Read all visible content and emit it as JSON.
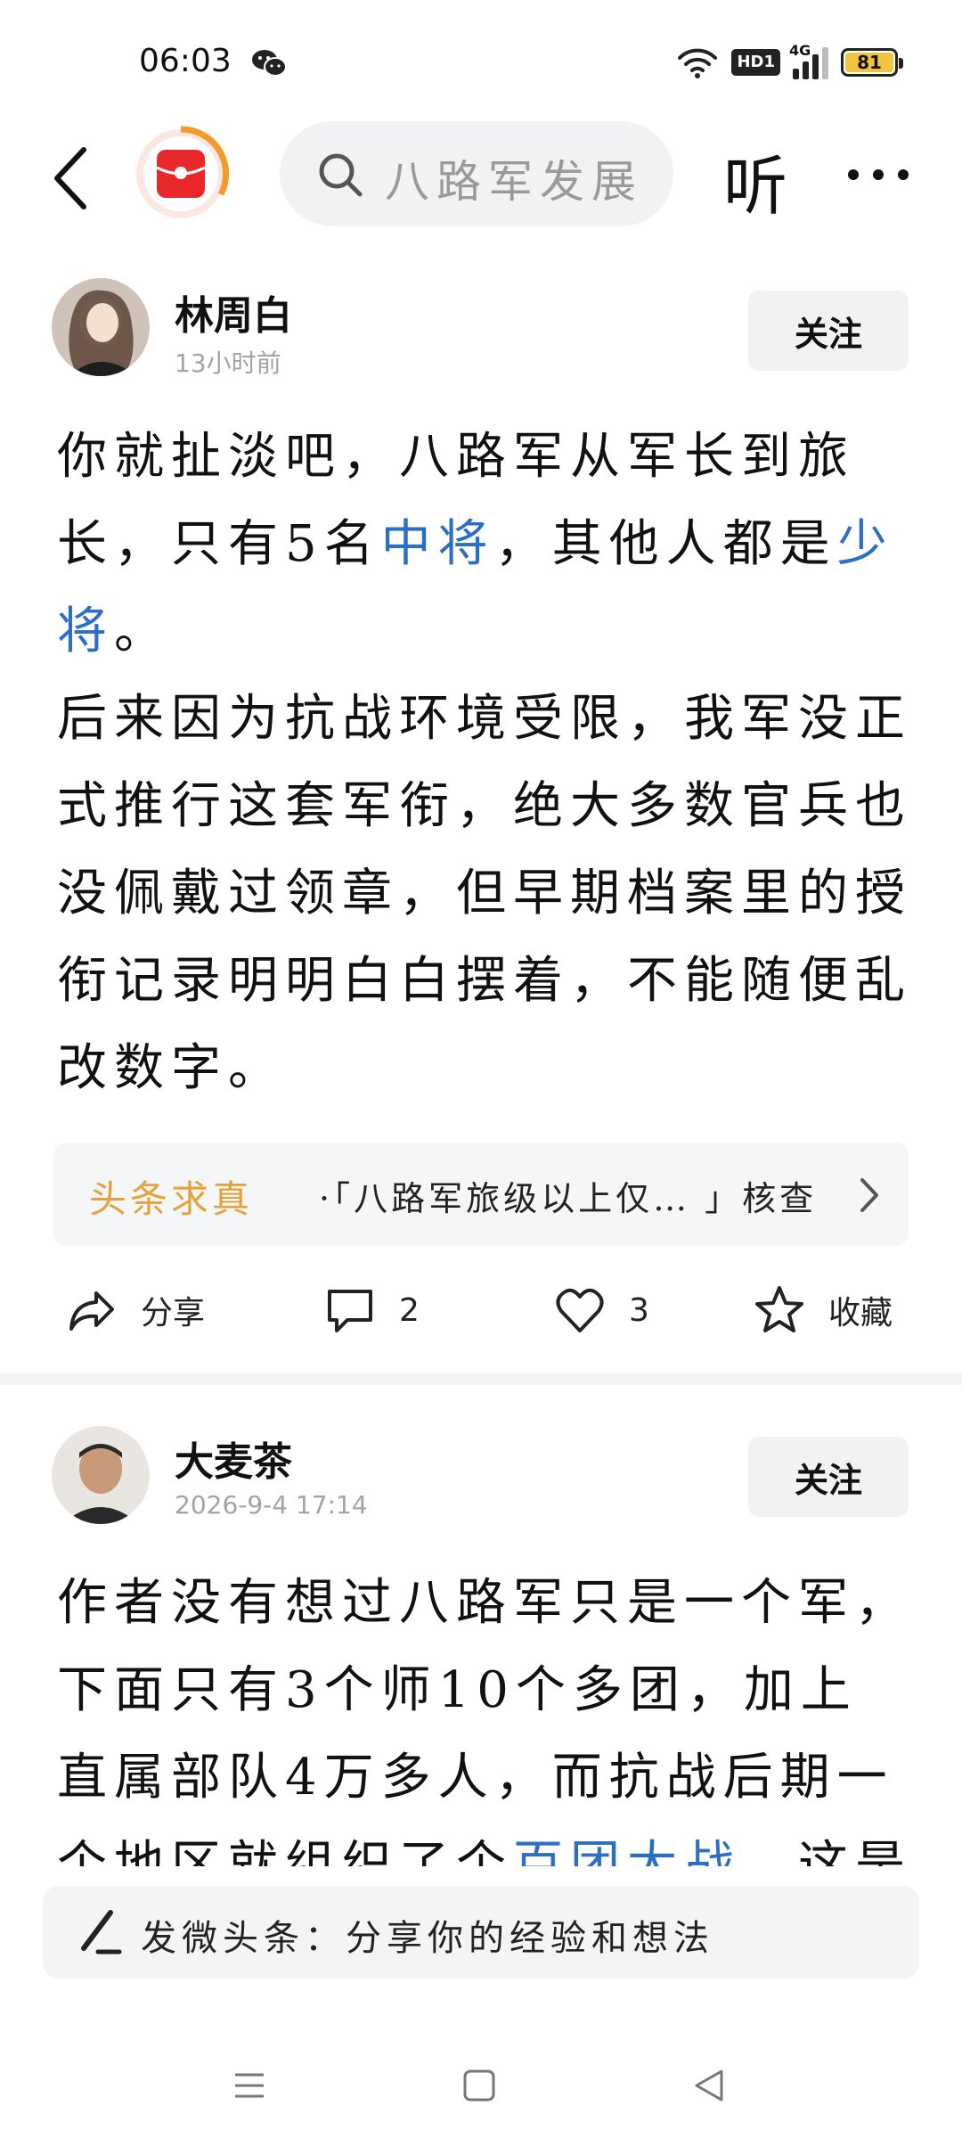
{
  "status": {
    "time": "06:03",
    "hd_label": "HD1",
    "net_label": "4G",
    "battery": "81",
    "icons": [
      "wechat-icon",
      "wifi-icon",
      "hd-icon",
      "signal-icon",
      "battery-icon"
    ]
  },
  "topnav": {
    "search_placeholder": "八路军发展",
    "listen_label": "听",
    "icons": [
      "back-icon",
      "red-packet-icon",
      "search-icon",
      "more-icon"
    ]
  },
  "posts": [
    {
      "author": "林周白",
      "time": "13小时前",
      "follow_label": "关注",
      "body": [
        {
          "text": "你就扯淡吧，八路军从军长到旅长，只有5名",
          "link": false
        },
        {
          "text": "中将",
          "link": true
        },
        {
          "text": "，其他人都是",
          "link": false
        },
        {
          "text": "少将",
          "link": true
        },
        {
          "text": "。",
          "link": false
        }
      ],
      "body2": "后来因为抗战环境受限，我军没正式推行这套军衔，绝大多数官兵也没佩戴过领章，但早期档案里的授衔记录明明白白摆着，不能随便乱改数字。",
      "factcheck": {
        "label": "头条求真",
        "text": "·「八路军旅级以上仅… 」核查"
      },
      "actions": {
        "share": "分享",
        "comments": "2",
        "likes": "3",
        "favorite": "收藏"
      }
    },
    {
      "author": "大麦茶",
      "time": "2026-9-4 17:14",
      "follow_label": "关注",
      "body": [
        {
          "text": "作者没有想过八路军只是一个军，下面只有3个师10个多团，加上直属部队4万多人，而抗战后期一个地区就组织了个",
          "link": false
        },
        {
          "text": "百团大战",
          "link": true
        },
        {
          "text": "，这是事",
          "link": false
        }
      ]
    }
  ],
  "composer": {
    "placeholder": "发微头条：分享你的经验和想法"
  },
  "navbar": {
    "icons": [
      "menu-icon",
      "home-icon",
      "back-triangle-icon"
    ]
  },
  "colors": {
    "link": "#2a6ec7",
    "factcheck_label": "#e3a23a",
    "battery": "#f3c43d"
  }
}
